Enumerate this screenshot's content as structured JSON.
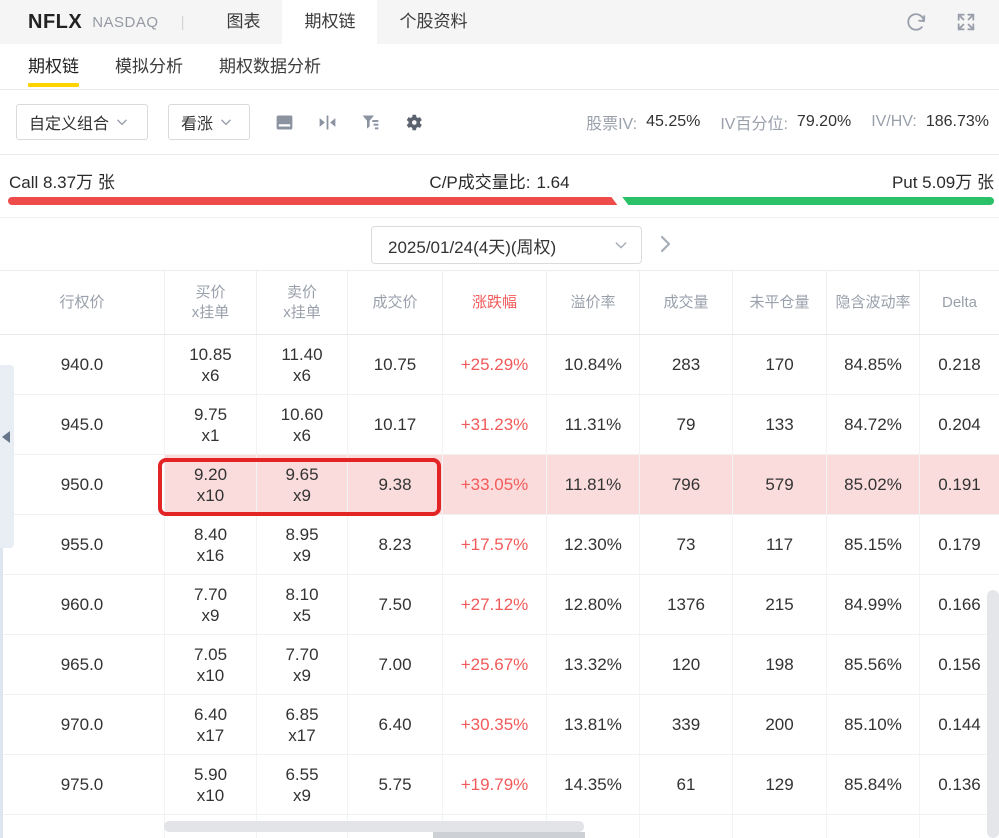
{
  "header": {
    "symbol": "NFLX",
    "exchange": "NASDAQ",
    "divider": "|",
    "tabs": [
      {
        "label": "图表",
        "active": false
      },
      {
        "label": "期权链",
        "active": true
      },
      {
        "label": "个股资料",
        "active": false
      }
    ]
  },
  "subnav": {
    "tabs": [
      {
        "label": "期权链",
        "active": true
      },
      {
        "label": "模拟分析",
        "active": false
      },
      {
        "label": "期权数据分析",
        "active": false
      }
    ]
  },
  "toolbar": {
    "strategy_select": "自定义组合",
    "direction_select": "看涨",
    "stats": [
      {
        "label": "股票IV:",
        "value": "45.25%"
      },
      {
        "label": "IV百分位:",
        "value": "79.20%"
      },
      {
        "label": "IV/HV:",
        "value": "186.73%"
      }
    ]
  },
  "volume_bar": {
    "call_label": "Call 8.37万 张",
    "ratio_label": "C/P成交量比:",
    "ratio_value": "1.64",
    "put_label": "Put 5.09万 张",
    "call_percent": 61.8,
    "put_percent": 37.7
  },
  "expiry": {
    "selected": "2025/01/24(4天)(周权)"
  },
  "table": {
    "columns": [
      {
        "key": "strike",
        "label": "行权价"
      },
      {
        "key": "bid",
        "label": "买价",
        "label2": "x挂单",
        "sub": "bid_size"
      },
      {
        "key": "ask",
        "label": "卖价",
        "label2": "x挂单",
        "sub": "ask_size"
      },
      {
        "key": "last",
        "label": "成交价"
      },
      {
        "key": "change",
        "label": "涨跌幅"
      },
      {
        "key": "premium",
        "label": "溢价率"
      },
      {
        "key": "volume",
        "label": "成交量"
      },
      {
        "key": "oi",
        "label": "未平仓量"
      },
      {
        "key": "iv",
        "label": "隐含波动率"
      },
      {
        "key": "delta",
        "label": "Delta"
      }
    ],
    "rows": [
      {
        "strike": "940.0",
        "bid": "10.85",
        "bid_size": "x6",
        "ask": "11.40",
        "ask_size": "x6",
        "last": "10.75",
        "change": "+25.29%",
        "premium": "10.84%",
        "volume": "283",
        "oi": "170",
        "iv": "84.85%",
        "delta": "0.218",
        "highlight": false
      },
      {
        "strike": "945.0",
        "bid": "9.75",
        "bid_size": "x1",
        "ask": "10.60",
        "ask_size": "x6",
        "last": "10.17",
        "change": "+31.23%",
        "premium": "11.31%",
        "volume": "79",
        "oi": "133",
        "iv": "84.72%",
        "delta": "0.204",
        "highlight": false
      },
      {
        "strike": "950.0",
        "bid": "9.20",
        "bid_size": "x10",
        "ask": "9.65",
        "ask_size": "x9",
        "last": "9.38",
        "change": "+33.05%",
        "premium": "11.81%",
        "volume": "796",
        "oi": "579",
        "iv": "85.02%",
        "delta": "0.191",
        "highlight": true
      },
      {
        "strike": "955.0",
        "bid": "8.40",
        "bid_size": "x16",
        "ask": "8.95",
        "ask_size": "x9",
        "last": "8.23",
        "change": "+17.57%",
        "premium": "12.30%",
        "volume": "73",
        "oi": "117",
        "iv": "85.15%",
        "delta": "0.179",
        "highlight": false
      },
      {
        "strike": "960.0",
        "bid": "7.70",
        "bid_size": "x9",
        "ask": "8.10",
        "ask_size": "x5",
        "last": "7.50",
        "change": "+27.12%",
        "premium": "12.80%",
        "volume": "1376",
        "oi": "215",
        "iv": "84.99%",
        "delta": "0.166",
        "highlight": false
      },
      {
        "strike": "965.0",
        "bid": "7.05",
        "bid_size": "x10",
        "ask": "7.70",
        "ask_size": "x9",
        "last": "7.00",
        "change": "+25.67%",
        "premium": "13.32%",
        "volume": "120",
        "oi": "198",
        "iv": "85.56%",
        "delta": "0.156",
        "highlight": false
      },
      {
        "strike": "970.0",
        "bid": "6.40",
        "bid_size": "x17",
        "ask": "6.85",
        "ask_size": "x17",
        "last": "6.40",
        "change": "+30.35%",
        "premium": "13.81%",
        "volume": "339",
        "oi": "200",
        "iv": "85.10%",
        "delta": "0.144",
        "highlight": false
      },
      {
        "strike": "975.0",
        "bid": "5.90",
        "bid_size": "x10",
        "ask": "6.55",
        "ask_size": "x9",
        "last": "5.75",
        "change": "+19.79%",
        "premium": "14.35%",
        "volume": "61",
        "oi": "129",
        "iv": "85.84%",
        "delta": "0.136",
        "highlight": false
      }
    ]
  },
  "icons": {
    "topbar": [
      "refresh-icon",
      "fullscreen-icon"
    ],
    "toolbar": [
      "board-icon",
      "collapse-columns-icon",
      "filter-icon",
      "settings-gear-icon"
    ],
    "misc": [
      "chevron-down-icon",
      "chevron-right-icon",
      "collapse-left-icon"
    ]
  },
  "colors": {
    "accent_yellow": "#ffd300",
    "call_red": "#ee4b4b",
    "put_green": "#2bc168",
    "change_red": "#f15a5a",
    "highlight_pink": "#fbdcdc",
    "highlight_box_red": "#e22424"
  }
}
